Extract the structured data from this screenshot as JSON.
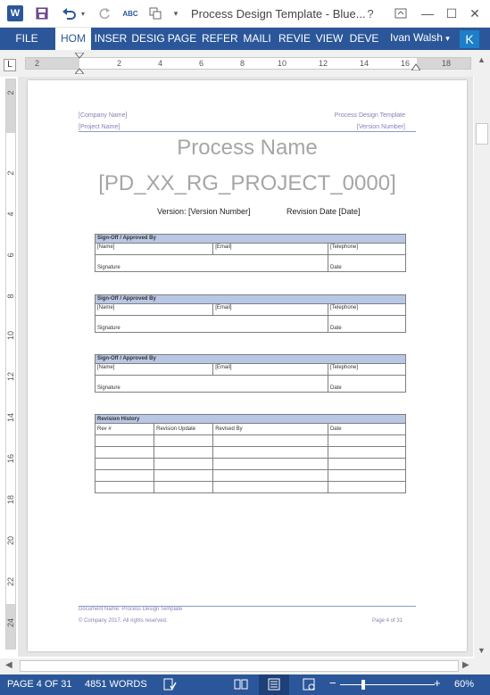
{
  "window": {
    "title": "Process Design Template - Blue...",
    "help": "?",
    "minimize": "—",
    "maximize": "☐",
    "close": "✕"
  },
  "quick_access": {
    "app_icon": "W",
    "save_icon": "save-icon",
    "undo_icon": "undo-icon",
    "redo_icon": "redo-icon",
    "spelling_icon": "spelling-icon",
    "format_icon": "format-icon",
    "customize_icon": "customize-icon"
  },
  "ribbon": {
    "tabs": [
      "FILE",
      "HOM",
      "INSER",
      "DESIG",
      "PAGE",
      "REFER",
      "MAILI",
      "REVIE",
      "VIEW",
      "DEVE"
    ],
    "user_name": "Ivan Walsh",
    "user_initial": "K"
  },
  "ruler": {
    "corner": "L",
    "h_numbers": [
      "2",
      "2",
      "4",
      "6",
      "8",
      "10",
      "12",
      "14",
      "16",
      "18"
    ],
    "v_numbers": [
      "2",
      "2",
      "4",
      "6",
      "8",
      "10",
      "12",
      "14",
      "16",
      "18",
      "20",
      "22",
      "24"
    ]
  },
  "document": {
    "company_name": "[Company Name]",
    "project_name": "[Project Name]",
    "template_name": "Process Design Template",
    "version_number": "[Version Number]",
    "process_name": "Process Name",
    "code": "[PD_XX_RG_PROJECT_0000]",
    "version_line": "Version: [Version Number]",
    "revision_date": "Revision Date [Date]",
    "signoff_tables": [
      {
        "heading": "Sign-Off / Approved By",
        "name": "[Name]",
        "email": "[Email]",
        "telephone": "[Telephone]",
        "signature": "Signature",
        "date": "Date"
      },
      {
        "heading": "Sign-Off / Approved By",
        "name": "[Name]",
        "email": "[Email]",
        "telephone": "[Telephone]",
        "signature": "Signature",
        "date": "Date"
      },
      {
        "heading": "Sign-Off / Approved By",
        "name": "[Name]",
        "email": "[Email]",
        "telephone": "[Telephone]",
        "signature": "Signature",
        "date": "Date"
      }
    ],
    "revision_history": {
      "heading": "Revision History",
      "columns": [
        "Rev #",
        "Revision Update",
        "Revised By",
        "Date"
      ]
    },
    "footer_docname": "Document Name: Process Design Template",
    "footer_copyright": "© Company 2017. All rights reserved.",
    "footer_page": "Page 4 of 31"
  },
  "status": {
    "page": "PAGE 4 OF 31",
    "words": "4851 WORDS",
    "zoom": "60%",
    "zoom_out": "−",
    "zoom_in": "+"
  },
  "colors": {
    "brand": "#2b579a",
    "table_header": "#b8c7e4",
    "header_text": "#8b7db5"
  }
}
